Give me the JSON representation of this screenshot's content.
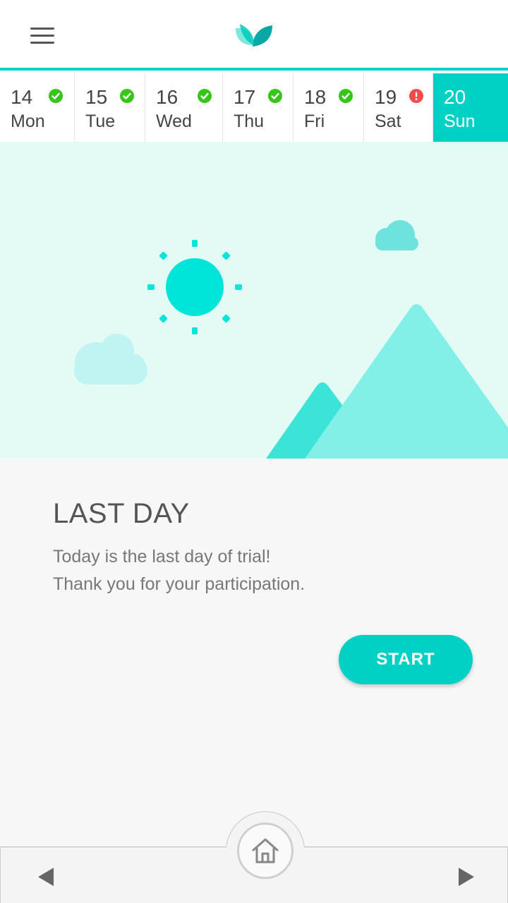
{
  "header": {
    "menu_icon": "hamburger-menu-icon",
    "logo_icon": "leaf-logo-icon"
  },
  "days": [
    {
      "num": "14",
      "name": "Mon",
      "status": "complete"
    },
    {
      "num": "15",
      "name": "Tue",
      "status": "complete"
    },
    {
      "num": "16",
      "name": "Wed",
      "status": "complete"
    },
    {
      "num": "17",
      "name": "Thu",
      "status": "complete"
    },
    {
      "num": "18",
      "name": "Fri",
      "status": "complete"
    },
    {
      "num": "19",
      "name": "Sat",
      "status": "alert"
    },
    {
      "num": "20",
      "name": "Sun",
      "status": "active"
    }
  ],
  "main": {
    "title": "LAST DAY",
    "line1": "Today is the last day of trial!",
    "line2": "Thank you for your participation.",
    "start_label": "START"
  },
  "nav": {
    "back_icon": "triangle-left-icon",
    "home_icon": "home-icon",
    "forward_icon": "triangle-right-icon"
  },
  "colors": {
    "accent": "#00d1c4",
    "complete": "#35c617",
    "alert": "#f44b4b",
    "scene_bg": "#e3faf5"
  }
}
